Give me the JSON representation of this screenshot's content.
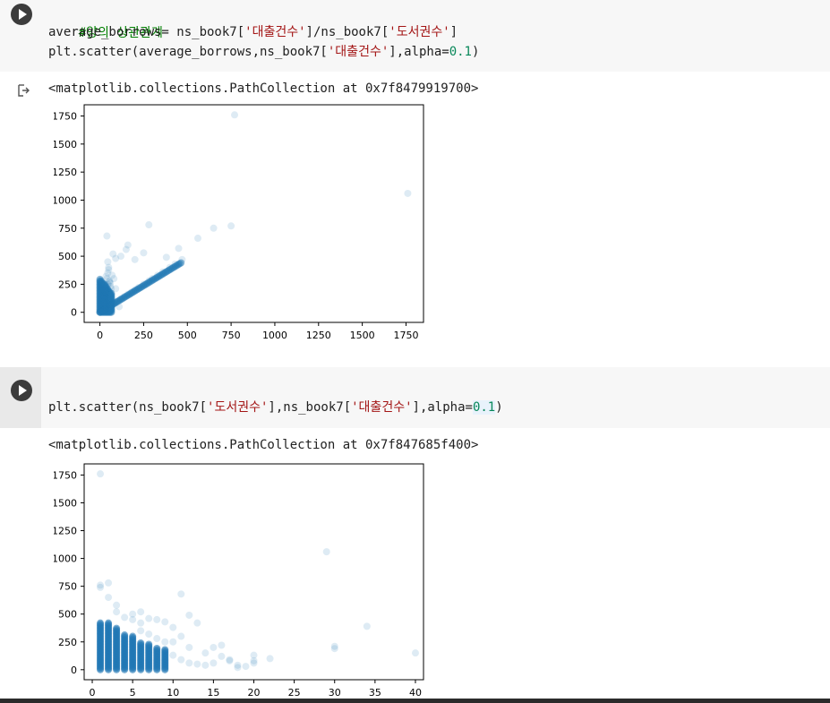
{
  "cell1": {
    "code": {
      "comment": "#양의 상관관계",
      "line2": [
        "average_borrows= ns_book7[",
        "'대출건수'",
        "]/ns_book7[",
        "'도서권수'",
        "]"
      ],
      "line3": [
        "plt.scatter(average_borrows,ns_book7[",
        "'대출건수'",
        "],alpha=",
        "0.1",
        ")"
      ]
    },
    "output_text": "<matplotlib.collections.PathCollection at 0x7f8479919700>"
  },
  "cell2": {
    "code": {
      "line1": [
        "plt.scatter(ns_book7[",
        "'도서권수'",
        "],ns_book7[",
        "'대출건수'",
        "],alpha=",
        "0.1",
        ")"
      ]
    },
    "output_text": "<matplotlib.collections.PathCollection at 0x7f847685f400>"
  },
  "chart_data": [
    {
      "type": "scatter",
      "title": "",
      "xlabel": "",
      "ylabel": "",
      "xlim": [
        -90,
        1850
      ],
      "ylim": [
        -90,
        1850
      ],
      "xticks": [
        0,
        250,
        500,
        750,
        1000,
        1250,
        1500,
        1750
      ],
      "yticks": [
        0,
        250,
        500,
        750,
        1000,
        1250,
        1500,
        1750
      ],
      "color": "#1f77b4",
      "alpha": 0.1,
      "x": [
        0,
        5,
        10,
        15,
        20,
        25,
        30,
        40,
        50,
        60,
        70,
        80,
        90,
        100,
        120,
        140,
        160,
        180,
        200,
        220,
        250,
        280,
        300,
        330,
        360,
        400,
        430,
        470,
        10,
        20,
        25,
        30,
        40,
        45,
        50,
        55,
        60,
        30,
        35,
        45,
        50,
        60,
        65,
        70,
        80,
        90,
        75,
        120,
        150,
        160,
        200,
        250,
        280,
        380,
        450,
        560,
        650,
        750,
        770,
        1760,
        40,
        60,
        20,
        35,
        55,
        90,
        110,
        15,
        25,
        45
      ],
      "y": [
        0,
        5,
        10,
        15,
        20,
        25,
        30,
        40,
        50,
        60,
        70,
        80,
        90,
        100,
        120,
        140,
        160,
        180,
        200,
        220,
        250,
        280,
        300,
        330,
        360,
        400,
        430,
        470,
        100,
        150,
        200,
        250,
        300,
        350,
        400,
        280,
        230,
        180,
        320,
        450,
        380,
        260,
        210,
        330,
        300,
        480,
        520,
        500,
        560,
        600,
        470,
        530,
        780,
        490,
        570,
        660,
        750,
        770,
        1760,
        1060,
        680,
        60,
        120,
        170,
        270,
        210,
        50,
        90,
        140,
        250
      ],
      "series": []
    },
    {
      "type": "scatter",
      "title": "",
      "xlabel": "",
      "ylabel": "",
      "xlim": [
        -1,
        41
      ],
      "ylim": [
        -90,
        1850
      ],
      "xticks": [
        0,
        5,
        10,
        15,
        20,
        25,
        30,
        35,
        40
      ],
      "yticks": [
        0,
        250,
        500,
        750,
        1000,
        1250,
        1500,
        1750
      ],
      "color": "#1f77b4",
      "alpha": 0.1,
      "columns_x": [
        1,
        2,
        3,
        4,
        5,
        6,
        7,
        8,
        9
      ],
      "columns_top": [
        420,
        420,
        380,
        320,
        300,
        250,
        230,
        200,
        180
      ],
      "x": [
        1,
        1,
        1,
        2,
        2,
        3,
        3,
        4,
        5,
        5,
        6,
        6,
        7,
        8,
        9,
        10,
        10,
        11,
        11,
        12,
        12,
        13,
        14,
        15,
        15,
        16,
        17,
        18,
        20,
        20,
        22,
        29,
        30,
        30,
        34,
        40,
        11,
        10,
        12,
        14,
        9,
        8,
        7,
        6,
        16,
        13,
        18,
        20,
        17,
        19
      ],
      "y": [
        1760,
        760,
        740,
        780,
        650,
        580,
        520,
        470,
        450,
        500,
        420,
        520,
        460,
        450,
        430,
        380,
        250,
        680,
        300,
        490,
        200,
        420,
        150,
        200,
        60,
        220,
        80,
        20,
        130,
        80,
        100,
        1060,
        210,
        190,
        390,
        150,
        90,
        130,
        60,
        40,
        250,
        280,
        320,
        350,
        120,
        50,
        40,
        60,
        90,
        30
      ],
      "series": []
    }
  ],
  "colors": {
    "code_bg": "#f7f7f7",
    "gutter": "#e9e9e9",
    "comment": "#008000",
    "string": "#a31515",
    "number": "#09885a",
    "point": "#1f77b4"
  },
  "icons": {
    "run": "play-icon",
    "output": "output-arrow-icon"
  }
}
